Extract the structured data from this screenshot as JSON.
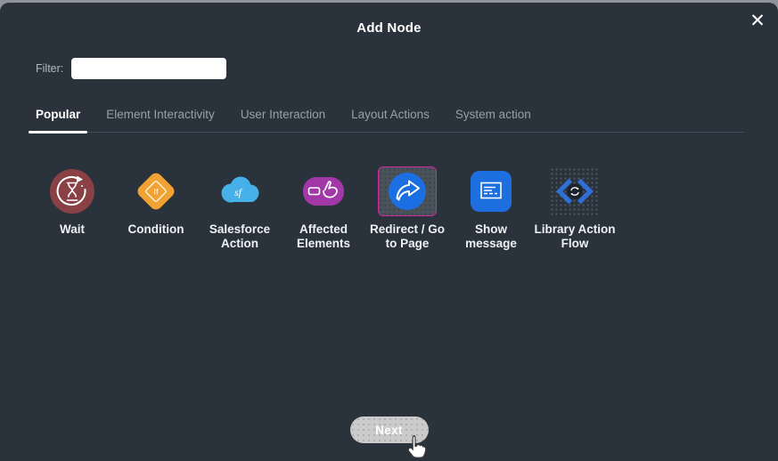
{
  "modal": {
    "title": "Add Node",
    "close_glyph": "✕"
  },
  "filter": {
    "label": "Filter:",
    "value": "",
    "placeholder": ""
  },
  "tabs": [
    {
      "label": "Popular",
      "active": true
    },
    {
      "label": "Element Interactivity",
      "active": false
    },
    {
      "label": "User Interaction",
      "active": false
    },
    {
      "label": "Layout Actions",
      "active": false
    },
    {
      "label": "System action",
      "active": false
    }
  ],
  "nodes": [
    {
      "label": "Wait",
      "icon": "wait-hourglass-icon",
      "color": "#8a4146",
      "selected": false
    },
    {
      "label": "Condition",
      "icon": "condition-if-diamond-icon",
      "icon_text": "If",
      "color": "#f0a232",
      "selected": false
    },
    {
      "label": "Salesforce Action",
      "icon": "salesforce-cloud-icon",
      "icon_text": "sf",
      "color": "#45b1e8",
      "selected": false
    },
    {
      "label": "Affected Elements",
      "icon": "hand-click-icon",
      "color": "#a238a8",
      "selected": false
    },
    {
      "label": "Redirect / Go to Page",
      "icon": "redirect-arrow-icon",
      "color": "#1c6fe2",
      "selected": true
    },
    {
      "label": "Show message",
      "icon": "message-box-icon",
      "color": "#1d6fdf",
      "selected": false
    },
    {
      "label": "Library Action Flow",
      "icon": "action-flow-brackets-icon",
      "color": "#2f6fd6",
      "selected": false
    }
  ],
  "footer": {
    "next_label": "Next"
  },
  "colors": {
    "modal_background": "#2a323b",
    "outside_background": "#8e9499",
    "selection_border": "#cf2a9c",
    "selection_fill": "#4a525c",
    "tab_inactive": "#98a0a7",
    "tab_active": "#ffffff",
    "divider": "#454e58",
    "next_button": "#cbcbcb",
    "label_text": "#eef1f3"
  }
}
